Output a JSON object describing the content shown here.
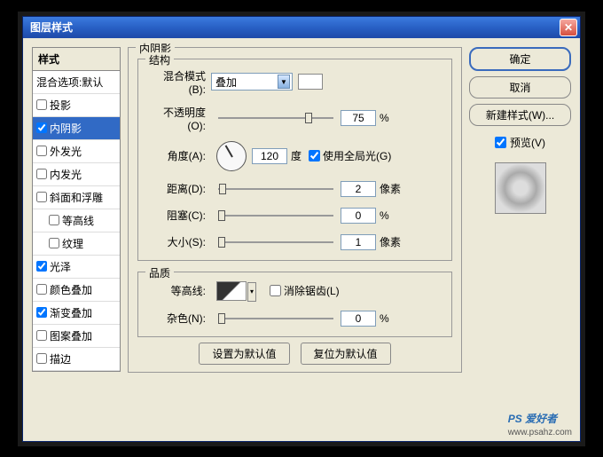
{
  "title": "图层样式",
  "close": "✕",
  "styles_header": "样式",
  "styles": [
    {
      "label": "混合选项:默认",
      "checked": null,
      "indent": false,
      "selected": false
    },
    {
      "label": "投影",
      "checked": false,
      "indent": false,
      "selected": false
    },
    {
      "label": "内阴影",
      "checked": true,
      "indent": false,
      "selected": true
    },
    {
      "label": "外发光",
      "checked": false,
      "indent": false,
      "selected": false
    },
    {
      "label": "内发光",
      "checked": false,
      "indent": false,
      "selected": false
    },
    {
      "label": "斜面和浮雕",
      "checked": false,
      "indent": false,
      "selected": false
    },
    {
      "label": "等高线",
      "checked": false,
      "indent": true,
      "selected": false
    },
    {
      "label": "纹理",
      "checked": false,
      "indent": true,
      "selected": false
    },
    {
      "label": "光泽",
      "checked": true,
      "indent": false,
      "selected": false
    },
    {
      "label": "颜色叠加",
      "checked": false,
      "indent": false,
      "selected": false
    },
    {
      "label": "渐变叠加",
      "checked": true,
      "indent": false,
      "selected": false
    },
    {
      "label": "图案叠加",
      "checked": false,
      "indent": false,
      "selected": false
    },
    {
      "label": "描边",
      "checked": false,
      "indent": false,
      "selected": false
    }
  ],
  "panel_title": "内阴影",
  "structure": {
    "legend": "结构",
    "blend_mode_label": "混合模式(B):",
    "blend_mode_value": "叠加",
    "opacity_label": "不透明度(O):",
    "opacity_value": "75",
    "opacity_unit": "%",
    "angle_label": "角度(A):",
    "angle_value": "120",
    "angle_unit": "度",
    "global_light_label": "使用全局光(G)",
    "global_light_checked": true,
    "distance_label": "距离(D):",
    "distance_value": "2",
    "distance_unit": "像素",
    "choke_label": "阻塞(C):",
    "choke_value": "0",
    "choke_unit": "%",
    "size_label": "大小(S):",
    "size_value": "1",
    "size_unit": "像素"
  },
  "quality": {
    "legend": "品质",
    "contour_label": "等高线:",
    "antialias_label": "消除锯齿(L)",
    "antialias_checked": false,
    "noise_label": "杂色(N):",
    "noise_value": "0",
    "noise_unit": "%"
  },
  "buttons": {
    "set_default": "设置为默认值",
    "reset_default": "复位为默认值"
  },
  "right": {
    "ok": "确定",
    "cancel": "取消",
    "new_style": "新建样式(W)...",
    "preview": "预览(V)",
    "preview_checked": true
  },
  "watermark": {
    "main": "PS 爱好者",
    "sub": "www.psahz.com"
  }
}
